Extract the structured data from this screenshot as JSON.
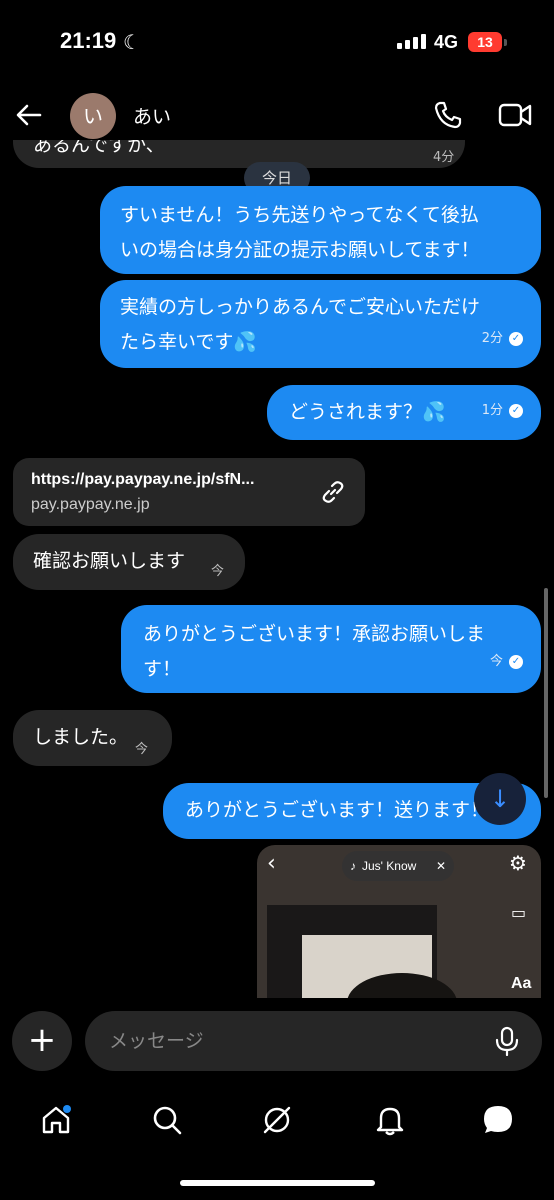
{
  "status_bar": {
    "time": "21:19",
    "network": "4G",
    "battery": "13"
  },
  "header": {
    "avatar_letter": "い",
    "contact_name": "あい"
  },
  "chat": {
    "truncated_message": {
      "text": "あるんですか、",
      "time": "4分"
    },
    "date_separator": "今日",
    "messages": [
      {
        "direction": "out",
        "lines": [
          "すいません！うち先送りやってなくて後払",
          "いの場合は身分証の提示お願いしてます！"
        ],
        "time": ""
      },
      {
        "direction": "out",
        "lines": [
          "実績の方しっかりあるんでご安心いただけ",
          "たら幸いです💦"
        ],
        "time": "2分"
      },
      {
        "direction": "out",
        "lines": [
          "どうされます？💦"
        ],
        "time": "1分"
      },
      {
        "direction": "in",
        "type": "link",
        "url": "https://pay.paypay.ne.jp/sfN...",
        "domain": "pay.paypay.ne.jp"
      },
      {
        "direction": "in",
        "lines": [
          "確認お願いします"
        ],
        "time": "今"
      },
      {
        "direction": "out",
        "lines": [
          "ありがとうございます！承認お願いしま",
          "す！"
        ],
        "time": "今"
      },
      {
        "direction": "in",
        "lines": [
          "しました。"
        ],
        "time": "今"
      },
      {
        "direction": "out",
        "lines": [
          "ありがとうございます！送ります！"
        ],
        "time": ""
      }
    ],
    "video": {
      "music_label": "Jus' Know",
      "text_tool": "Aa"
    }
  },
  "composer": {
    "placeholder": "メッセージ"
  },
  "nav": {
    "items": [
      "home-icon",
      "search-icon",
      "explore-icon",
      "notifications-icon",
      "messages-icon"
    ],
    "accent": "#1d8af2"
  },
  "colors": {
    "outgoing_bubble": "#1d8af2",
    "incoming_bubble": "#262626",
    "background": "#000000"
  }
}
